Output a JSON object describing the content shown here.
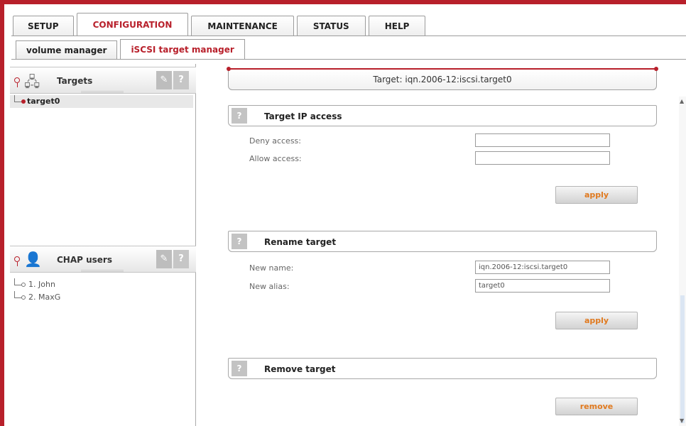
{
  "tabs": {
    "main": [
      "SETUP",
      "CONFIGURATION",
      "MAINTENANCE",
      "STATUS",
      "HELP"
    ],
    "active_main": "CONFIGURATION",
    "sub": [
      "volume manager",
      "iSCSI target manager"
    ],
    "active_sub": "iSCSI target manager"
  },
  "left": {
    "targets_panel": {
      "title": "Targets",
      "help": "?",
      "items": [
        "target0"
      ]
    },
    "chap_panel": {
      "title": "CHAP users",
      "help": "?",
      "items": [
        "1. John",
        "2. MaxG"
      ]
    }
  },
  "main": {
    "header": "Target: iqn.2006-12:iscsi.target0",
    "ip_access": {
      "help": "?",
      "title": "Target IP access",
      "deny_label": "Deny access:",
      "deny_value": "",
      "allow_label": "Allow access:",
      "allow_value": "",
      "apply": "apply"
    },
    "rename": {
      "help": "?",
      "title": "Rename target",
      "name_label": "New name:",
      "name_value": "iqn.2006-12:iscsi.target0",
      "alias_label": "New alias:",
      "alias_value": "target0",
      "apply": "apply"
    },
    "remove": {
      "help": "?",
      "title": "Remove target",
      "button": "remove"
    }
  },
  "colors": {
    "accent": "#b8202b",
    "button_text": "#e0791e"
  }
}
